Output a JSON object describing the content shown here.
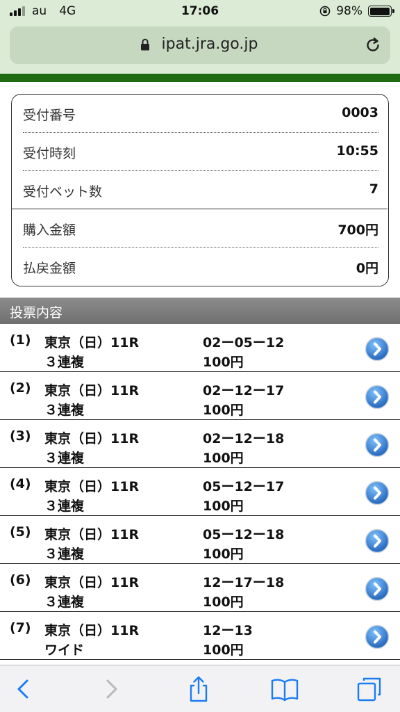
{
  "status_bar": {
    "carrier": "au",
    "network": "4G",
    "time": "17:06",
    "battery": "98%",
    "battery_level": 0.98
  },
  "browser": {
    "url": "ipat.jra.go.jp"
  },
  "summary": {
    "rows": [
      {
        "label": "受付番号",
        "value": "0003"
      },
      {
        "label": "受付時刻",
        "value": "10:55"
      },
      {
        "label": "受付ベット数",
        "value": "7"
      },
      {
        "label": "購入金額",
        "value": "700円"
      },
      {
        "label": "払戻金額",
        "value": "0円"
      }
    ]
  },
  "tickets": {
    "header": "投票内容",
    "items": [
      {
        "index": "(1)",
        "race": "東京（日）11R",
        "bet_type": "３連複",
        "combination": "02ー05ー12",
        "amount": "100円"
      },
      {
        "index": "(2)",
        "race": "東京（日）11R",
        "bet_type": "３連複",
        "combination": "02ー12ー17",
        "amount": "100円"
      },
      {
        "index": "(3)",
        "race": "東京（日）11R",
        "bet_type": "３連複",
        "combination": "02ー12ー18",
        "amount": "100円"
      },
      {
        "index": "(4)",
        "race": "東京（日）11R",
        "bet_type": "３連複",
        "combination": "05ー12ー17",
        "amount": "100円"
      },
      {
        "index": "(5)",
        "race": "東京（日）11R",
        "bet_type": "３連複",
        "combination": "05ー12ー18",
        "amount": "100円"
      },
      {
        "index": "(6)",
        "race": "東京（日）11R",
        "bet_type": "３連複",
        "combination": "12ー17ー18",
        "amount": "100円"
      },
      {
        "index": "(7)",
        "race": "東京（日）11R",
        "bet_type": "ワイド",
        "combination": "12ー13",
        "amount": "100円"
      }
    ]
  },
  "colors": {
    "brand_green": "#1f6b12",
    "header_gray": "#7a7a7a",
    "arrow_blue": "#2f7fd1",
    "toolbar_blue": "#1a7cf5"
  },
  "icons": {
    "toolbar": [
      "back-icon",
      "forward-icon",
      "share-icon",
      "bookmarks-icon",
      "tabs-icon"
    ],
    "row_action": "chevron-right-circle-icon"
  }
}
